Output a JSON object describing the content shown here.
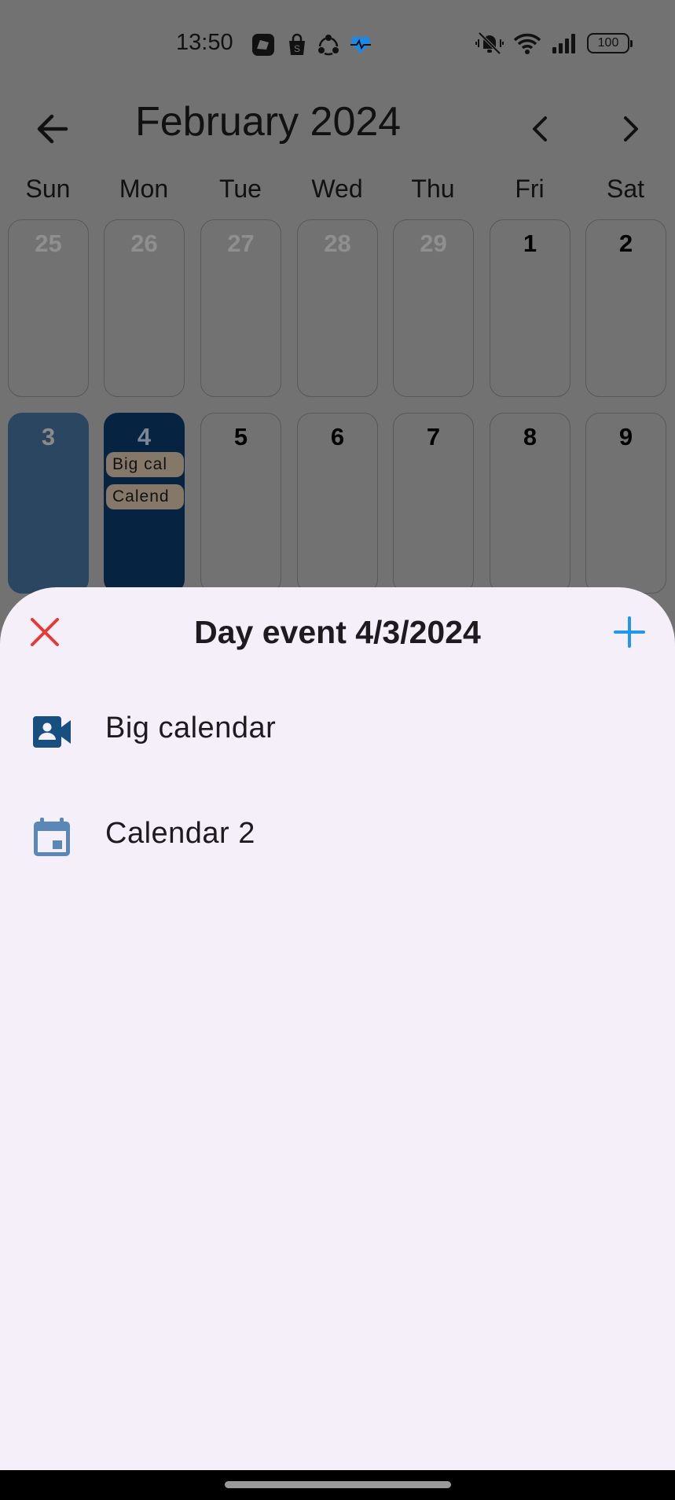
{
  "status_bar": {
    "time": "13:50",
    "battery": "100",
    "icons": [
      "app-notification-icon",
      "shopping-bag-icon",
      "share-icon",
      "heart-pulse-icon",
      "mute-vibrate-icon",
      "wifi-icon",
      "signal-icon"
    ]
  },
  "header": {
    "title": "February 2024",
    "back_icon": "arrow-left-icon",
    "prev_icon": "chevron-left-icon",
    "next_icon": "chevron-right-icon"
  },
  "weekdays": [
    "Sun",
    "Mon",
    "Tue",
    "Wed",
    "Thu",
    "Fri",
    "Sat"
  ],
  "week1": [
    "25",
    "26",
    "27",
    "28",
    "29",
    "1",
    "2"
  ],
  "week2": [
    "3",
    "4",
    "5",
    "6",
    "7",
    "8",
    "9"
  ],
  "week2_events": {
    "mon": [
      "Big cal",
      "Calend"
    ]
  },
  "sheet": {
    "title": "Day event 4/3/2024",
    "close_icon": "close-icon",
    "add_icon": "plus-icon",
    "events": [
      {
        "label": "Big calendar",
        "icon": "video-contact-icon"
      },
      {
        "label": "Calendar 2",
        "icon": "calendar-icon"
      }
    ]
  },
  "colors": {
    "scrim": "#727272",
    "sheet_bg": "#f4eff9",
    "close_red": "#e53935",
    "add_blue": "#2196f3",
    "selected_day": "#2b4660",
    "today": "#062442",
    "event_chip": "#857868",
    "icon_blue_dark": "#164f80",
    "icon_blue_light": "#5b87b7"
  }
}
